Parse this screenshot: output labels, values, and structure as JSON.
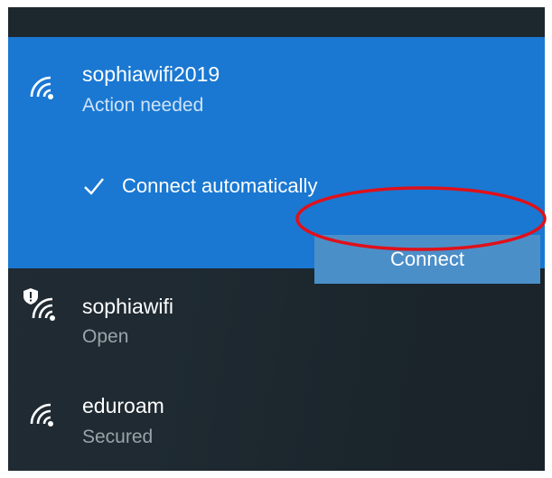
{
  "colors": {
    "selected_bg": "#1a78d2",
    "panel_bg": "#1f2a32",
    "connect_button_bg": "#4b8fc9",
    "annotation_ring": "#e0101a"
  },
  "networks": [
    {
      "ssid": "sophiawifi2019",
      "status": "Action needed",
      "icon": "wifi-signal-icon",
      "selected": true,
      "connect_automatically": {
        "label": "Connect automatically",
        "checked": true
      },
      "connect_button": "Connect"
    },
    {
      "ssid": "sophiawifi",
      "status": "Open",
      "icon": "wifi-signal-shield-warning-icon",
      "selected": false
    },
    {
      "ssid": "eduroam",
      "status": "Secured",
      "icon": "wifi-signal-icon",
      "selected": false
    }
  ]
}
